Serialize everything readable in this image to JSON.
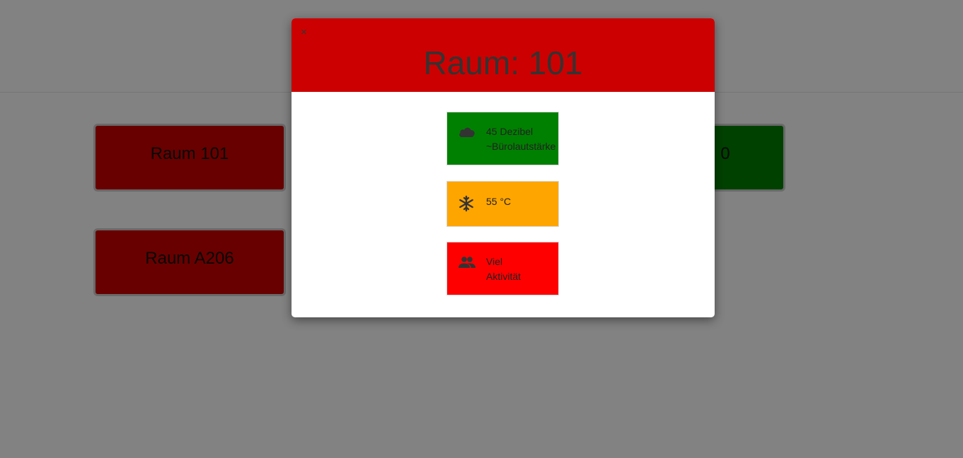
{
  "rooms": [
    {
      "label": "Raum 101",
      "status_color": "#cc0000"
    },
    {
      "label": "Raum A206",
      "status_color": "#cc0000"
    },
    {
      "label": "0",
      "status_color": "#008000"
    }
  ],
  "modal": {
    "close_label": "×",
    "title": "Raum: 101",
    "header_color": "#cc0000",
    "metrics": [
      {
        "icon": "cloud-icon",
        "line1": "45 Dezibel",
        "line2": "~Bürolautstärke",
        "color": "#008000"
      },
      {
        "icon": "snowflake-icon",
        "line1": "55 °C",
        "color": "#ffa500"
      },
      {
        "icon": "people-icon",
        "line1": "Viel",
        "line2": "Aktivität",
        "color": "#ff0000"
      }
    ]
  }
}
